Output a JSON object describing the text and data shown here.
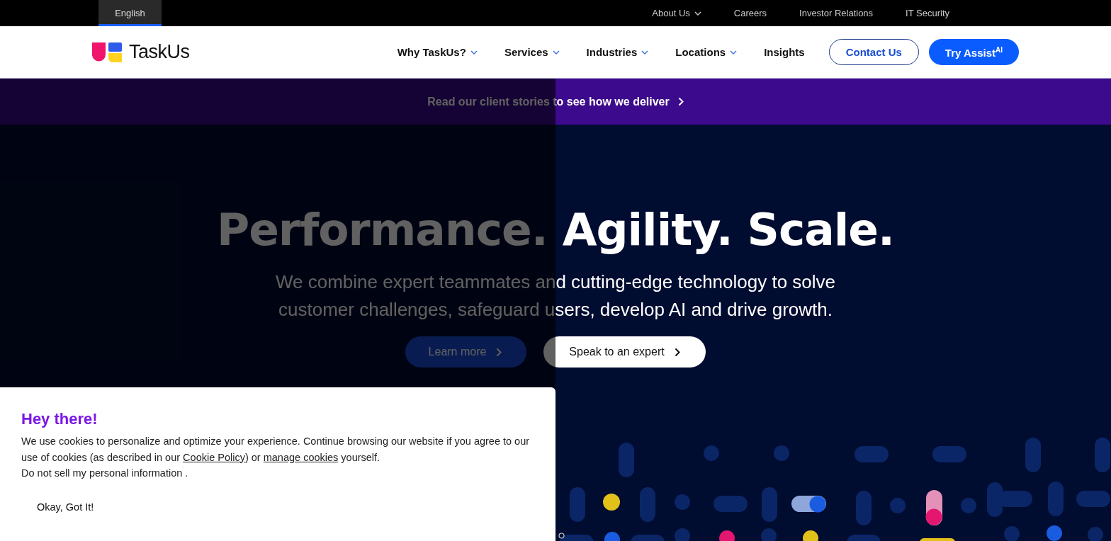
{
  "top_bar": {
    "language_tab": {
      "label": "English",
      "selected": true
    },
    "links": [
      {
        "label": "About Us",
        "has_dropdown": true
      },
      {
        "label": "Careers",
        "has_dropdown": false
      },
      {
        "label": "Investor Relations",
        "has_dropdown": false
      },
      {
        "label": "IT Security",
        "has_dropdown": false
      }
    ]
  },
  "nav": {
    "logo_text": "TaskUs",
    "items": [
      {
        "label": "Why TaskUs?",
        "has_dropdown": true
      },
      {
        "label": "Services",
        "has_dropdown": true
      },
      {
        "label": "Industries",
        "has_dropdown": true
      },
      {
        "label": "Locations",
        "has_dropdown": true
      },
      {
        "label": "Insights",
        "has_dropdown": false
      }
    ],
    "buttons": [
      {
        "label": "Contact Us",
        "kind": "outline"
      },
      {
        "label": "Try Assist$^{AI}$",
        "kind": "filled"
      }
    ]
  },
  "banner": {
    "text": "Read our client stories to see how we deliver"
  },
  "hero": {
    "headline": "Performance. Agility. Scale.",
    "subtitle": "We combine expert teammates and cutting-edge technology to solve customer challenges, safeguard users, develop AI and drive growth.",
    "buttons": [
      {
        "label": "Learn more",
        "kind": "primary"
      },
      {
        "label": "Speak to an expert",
        "kind": "secondary"
      }
    ]
  },
  "cookie_notice": {
    "dims_page": true,
    "title": "Hey there!",
    "body": [
      {
        "kind": "text",
        "text": "We use cookies to personalize and optimize your experience. Continue browsing our website if you agree to our use of cookies (as described in our "
      },
      {
        "kind": "link",
        "text": "Cookie Policy"
      },
      {
        "kind": "text",
        "text": ") or "
      },
      {
        "kind": "link",
        "text": "manage cookies"
      },
      {
        "kind": "text",
        "text": " yourself."
      }
    ],
    "note": "Do not sell my personal information .",
    "button": "Okay, Got It!"
  }
}
